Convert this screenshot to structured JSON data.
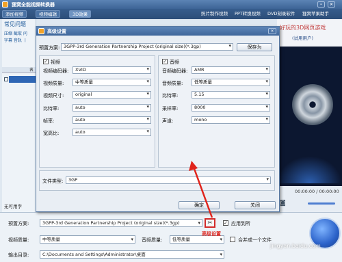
{
  "app": {
    "title": "狸窝全能视频转换器",
    "toolbar": {
      "add_video": "添加视频",
      "video_edit": "视频编辑",
      "effect_3d": "3D效果",
      "links": [
        "照片制作视频",
        "PPT转换视频",
        "DVD刻录软件",
        "狸窝苹果助手"
      ]
    },
    "left": {
      "section_title": "常见问题",
      "mini_rows": [
        "压缩 截取 问",
        "字幕 音轨 丨"
      ],
      "colhead": "名",
      "footer": "无可用字"
    },
    "preview": {
      "banner_line1": "好玩的3D网页游戏",
      "banner_line2": "(试用用户)",
      "time": "00:00:00 / 00:00:00"
    }
  },
  "dialog": {
    "title": "高级设置",
    "preset_label": "预置方案:",
    "preset_value": "3GPP-3rd Generation Partnership Project (original size)(*.3gp)",
    "save_as": "保存为",
    "video": {
      "label": "视频",
      "checked": true,
      "rows": [
        {
          "label": "视频编码器:",
          "value": "XVID"
        },
        {
          "label": "视频质量:",
          "value": "中等质量"
        },
        {
          "label": "视频尺寸:",
          "value": "original"
        },
        {
          "label": "比特率:",
          "value": "auto"
        },
        {
          "label": "帧率:",
          "value": "auto"
        },
        {
          "label": "宽高比:",
          "value": "auto"
        }
      ]
    },
    "audio": {
      "label": "音频",
      "checked": true,
      "rows": [
        {
          "label": "音频编码器:",
          "value": "AMR"
        },
        {
          "label": "音频质量:",
          "value": "低等质量"
        },
        {
          "label": "比特率:",
          "value": "5.15"
        },
        {
          "label": "采样率:",
          "value": "8000"
        },
        {
          "label": "声道:",
          "value": "mono"
        }
      ]
    },
    "file_type_label": "文件类型:",
    "file_type_value": "3GP",
    "ok": "确定",
    "close": "关闭"
  },
  "bottom": {
    "preset_label": "预置方案:",
    "preset_value": "3GPP-3rd Generation Partnership Project (original size)(*.3gp)",
    "apply_all": "应用到所",
    "video_quality_label": "视频质量:",
    "video_quality_value": "中等质量",
    "audio_quality_label": "音频质量:",
    "audio_quality_value": "低等质量",
    "merge_label": "合并成一个文件",
    "output_label": "输出目录:",
    "output_value": "C:\\Documents and Settings\\Administrator\\桌面"
  },
  "annotation": {
    "text": "高级设置",
    "color": "#e0241c"
  },
  "watermark": "jingyan.baidu.com"
}
